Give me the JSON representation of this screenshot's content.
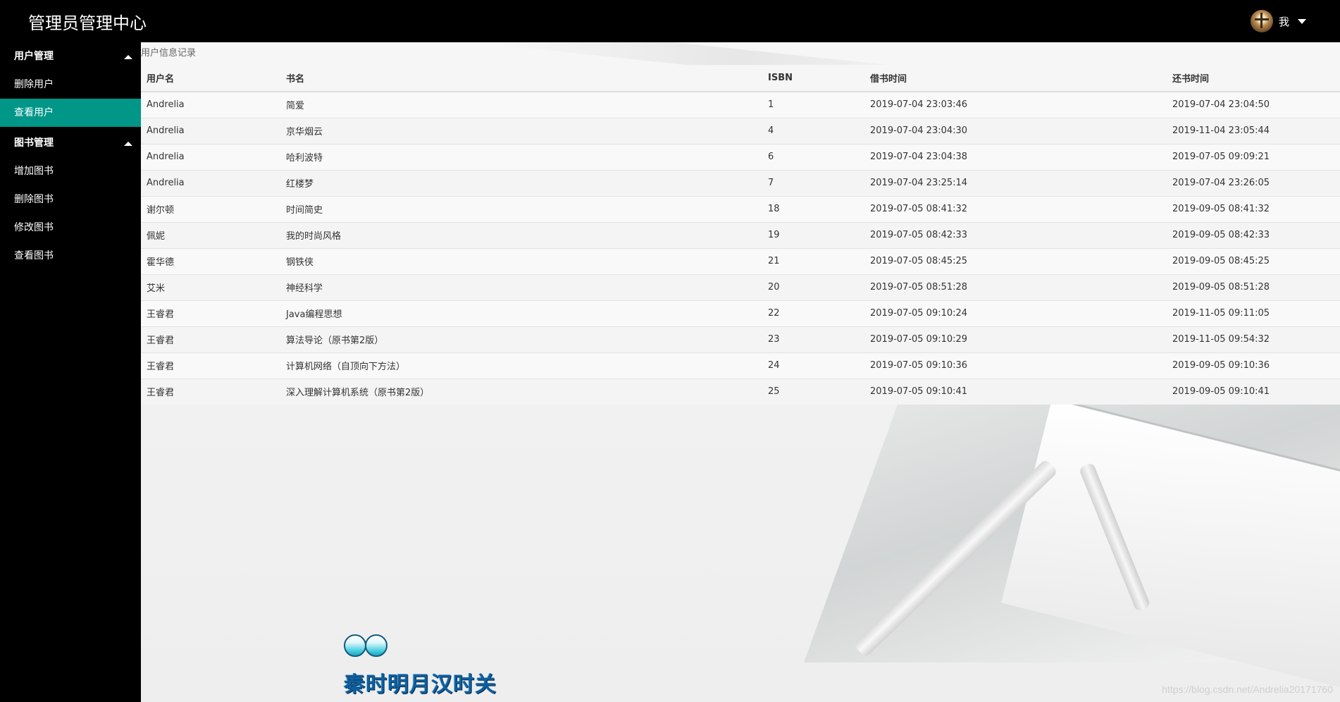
{
  "app": {
    "title": "管理员管理中心",
    "user_label": "我"
  },
  "sidebar": {
    "groups": [
      {
        "label": "用户管理",
        "items": [
          {
            "label": "删除用户"
          },
          {
            "label": "查看用户"
          }
        ]
      },
      {
        "label": "图书管理",
        "items": [
          {
            "label": "增加图书"
          },
          {
            "label": "删除图书"
          },
          {
            "label": "修改图书"
          },
          {
            "label": "查看图书"
          }
        ]
      }
    ],
    "active_item": "查看用户",
    "active_color": "#009688"
  },
  "main": {
    "caption": "用户信息记录",
    "columns": [
      "用户名",
      "书名",
      "ISBN",
      "借书时间",
      "还书时间"
    ],
    "rows": [
      [
        "Andrelia",
        "简爱",
        "1",
        "2019-07-04 23:03:46",
        "2019-07-04 23:04:50"
      ],
      [
        "Andrelia",
        "京华烟云",
        "4",
        "2019-07-04 23:04:30",
        "2019-11-04 23:05:44"
      ],
      [
        "Andrelia",
        "哈利波特",
        "6",
        "2019-07-04 23:04:38",
        "2019-07-05 09:09:21"
      ],
      [
        "Andrelia",
        "红楼梦",
        "7",
        "2019-07-04 23:25:14",
        "2019-07-04 23:26:05"
      ],
      [
        "谢尔顿",
        "时间简史",
        "18",
        "2019-07-05 08:41:32",
        "2019-09-05 08:41:32"
      ],
      [
        "佩妮",
        "我的时尚风格",
        "19",
        "2019-07-05 08:42:33",
        "2019-09-05 08:42:33"
      ],
      [
        "霍华德",
        "钢铁侠",
        "21",
        "2019-07-05 08:45:25",
        "2019-09-05 08:45:25"
      ],
      [
        "艾米",
        "神经科学",
        "20",
        "2019-07-05 08:51:28",
        "2019-09-05 08:51:28"
      ],
      [
        "王睿君",
        "Java编程思想",
        "22",
        "2019-07-05 09:10:24",
        "2019-11-05 09:11:05"
      ],
      [
        "王睿君",
        "算法导论（原书第2版）",
        "23",
        "2019-07-05 09:10:29",
        "2019-11-05 09:54:32"
      ],
      [
        "王睿君",
        "计算机网络（自顶向下方法）",
        "24",
        "2019-07-05 09:10:36",
        "2019-09-05 09:10:36"
      ],
      [
        "王睿君",
        "深入理解计算机系统（原书第2版）",
        "25",
        "2019-07-05 09:10:41",
        "2019-09-05 09:10:41"
      ]
    ]
  },
  "decoration": {
    "motto": "秦时明月汉时关"
  },
  "watermark": "https://blog.csdn.net/Andrelia20171760",
  "icons": {
    "avatar": "user-avatar-icon",
    "dropdown": "caret-down-icon",
    "collapse": "caret-up-icon"
  }
}
